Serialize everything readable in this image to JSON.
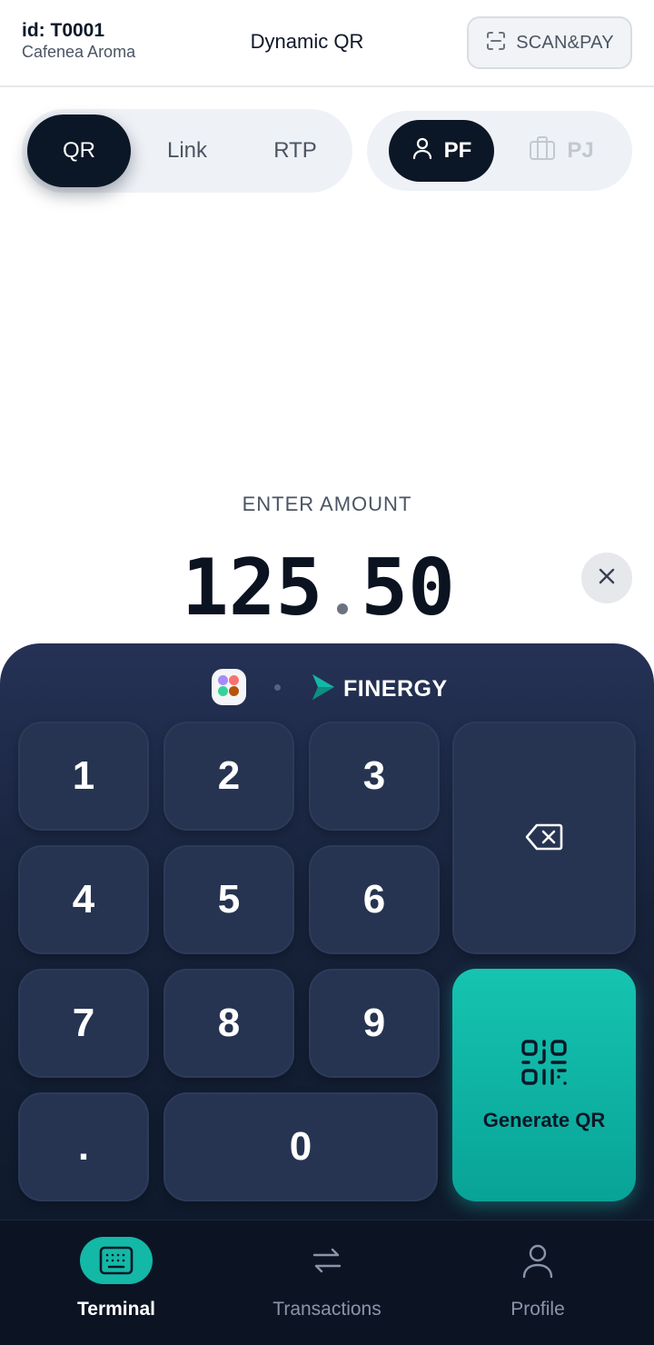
{
  "header": {
    "terminal_id": "id: T0001",
    "merchant": "Cafenea Aroma",
    "title": "Dynamic QR",
    "scan_label": "SCAN&PAY"
  },
  "mode_tabs": [
    {
      "label": "QR",
      "active": true
    },
    {
      "label": "Link",
      "active": false
    },
    {
      "label": "RTP",
      "active": false
    }
  ],
  "entity_tabs": [
    {
      "label": "PF",
      "icon": "person-icon",
      "active": true
    },
    {
      "label": "PJ",
      "icon": "briefcase-icon",
      "active": false
    }
  ],
  "amount": {
    "label": "ENTER AMOUNT",
    "integer": "125",
    "decimal": "50"
  },
  "keypad": {
    "brand": "FINERGY",
    "keys": [
      "1",
      "2",
      "3",
      "4",
      "5",
      "6",
      "7",
      "8",
      "9",
      ".",
      "0"
    ],
    "generate_label": "Generate QR"
  },
  "nav": [
    {
      "label": "Terminal",
      "icon": "keyboard-icon",
      "active": true
    },
    {
      "label": "Transactions",
      "icon": "transfer-arrows-icon",
      "active": false
    },
    {
      "label": "Profile",
      "icon": "user-icon",
      "active": false
    }
  ],
  "colors": {
    "accent": "#14b8a6",
    "dark": "#0b1727",
    "panel": "#1e2a46"
  }
}
